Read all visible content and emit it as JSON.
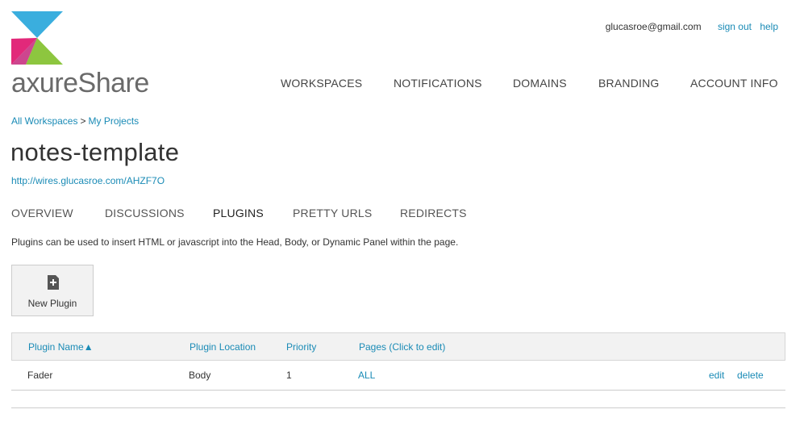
{
  "header": {
    "logo_text": "axureShare",
    "user_email": "glucasroe@gmail.com",
    "sign_out_label": "sign out",
    "help_label": "help",
    "colors": {
      "logo_blue": "#3aaede",
      "logo_pink": "#e2297a",
      "logo_green": "#8dc63f",
      "link": "#1a8bb6"
    }
  },
  "main_nav": {
    "items": [
      {
        "label": "WORKSPACES"
      },
      {
        "label": "NOTIFICATIONS"
      },
      {
        "label": "DOMAINS"
      },
      {
        "label": "BRANDING"
      },
      {
        "label": "ACCOUNT INFO"
      }
    ]
  },
  "breadcrumb": {
    "items": [
      {
        "label": "All Workspaces"
      },
      {
        "label": "My Projects"
      }
    ],
    "separator": ">"
  },
  "project": {
    "title": "notes-template",
    "url": "http://wires.glucasroe.com/AHZF7O"
  },
  "sub_tabs": {
    "items": [
      {
        "label": "OVERVIEW"
      },
      {
        "label": "DISCUSSIONS"
      },
      {
        "label": "PLUGINS",
        "active": true
      },
      {
        "label": "PRETTY URLS"
      },
      {
        "label": "REDIRECTS"
      }
    ]
  },
  "plugins": {
    "description": "Plugins can be used to insert HTML or javascript into the Head, Body, or Dynamic Panel within the page.",
    "new_plugin_label": "New Plugin",
    "new_plugin_icon": "add-file-icon",
    "table": {
      "headers": [
        "Plugin Name▲",
        "Plugin Location",
        "Priority",
        "Pages (Click to edit)"
      ],
      "rows": [
        {
          "name": "Fader",
          "location": "Body",
          "priority": "1",
          "pages": "ALL",
          "edit_label": "edit",
          "delete_label": "delete"
        }
      ]
    }
  }
}
